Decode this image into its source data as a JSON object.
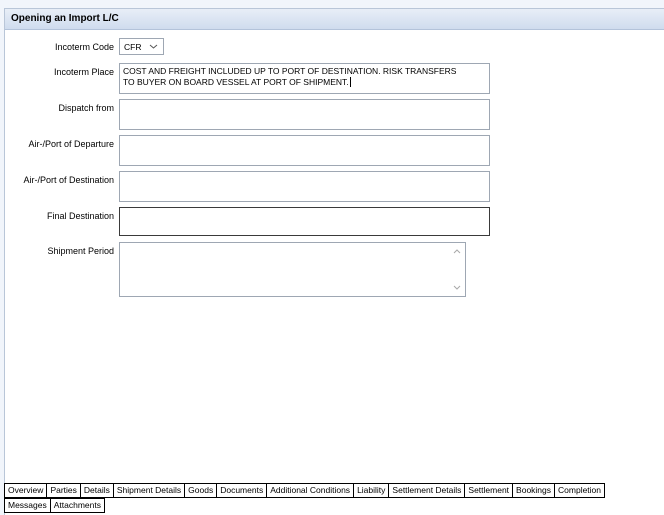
{
  "window": {
    "title": "Opening an Import L/C"
  },
  "form": {
    "incoterm_code": {
      "label": "Incoterm Code",
      "value": "CFR"
    },
    "incoterm_place": {
      "label": "Incoterm Place",
      "line1": "COST AND FREIGHT INCLUDED UP TO PORT OF DESTINATION. RISK TRANSFERS",
      "line2": "TO BUYER ON BOARD VESSEL AT PORT OF SHIPMENT."
    },
    "dispatch_from": {
      "label": "Dispatch from",
      "value": ""
    },
    "port_departure": {
      "label": "Air-/Port of Departure",
      "value": ""
    },
    "port_destination": {
      "label": "Air-/Port of Destination",
      "value": ""
    },
    "final_destination": {
      "label": "Final Destination",
      "value": ""
    },
    "shipment_period": {
      "label": "Shipment Period",
      "value": ""
    }
  },
  "tabs": {
    "row1": [
      "Overview",
      "Parties",
      "Details",
      "Shipment Details",
      "Goods",
      "Documents",
      "Additional Conditions",
      "Liability",
      "Settlement Details",
      "Settlement",
      "Bookings",
      "Completion"
    ],
    "row2": [
      "Messages",
      "Attachments"
    ],
    "active": "Shipment Details"
  },
  "icons": {
    "dropdown": "chevron-down-icon",
    "scroll_up": "chevron-up-icon",
    "scroll_down": "chevron-down-icon"
  },
  "colors": {
    "title_bar": "#d6e1f0",
    "field_border": "#9ea7b3",
    "page_background": "#f1f5fb"
  }
}
